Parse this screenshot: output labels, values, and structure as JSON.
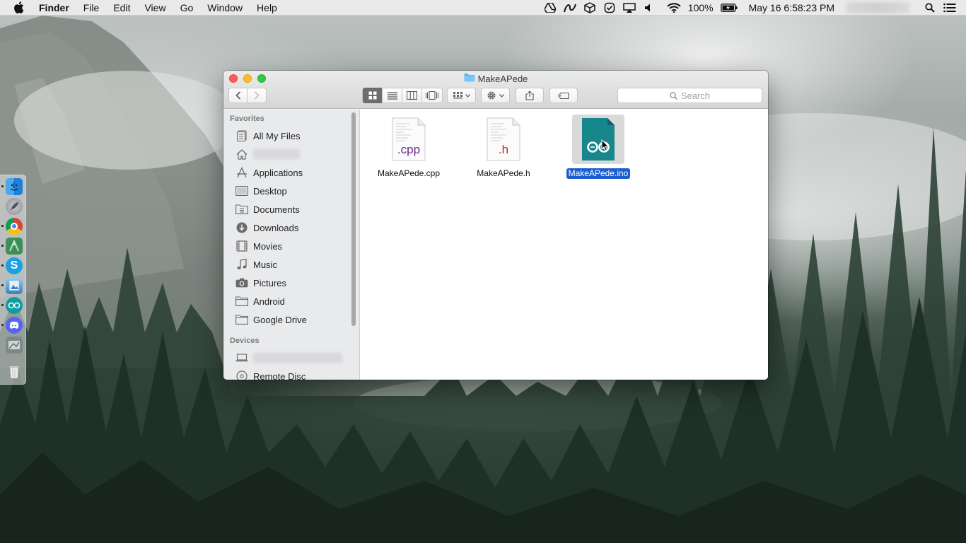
{
  "menubar": {
    "app_name": "Finder",
    "menus": [
      "File",
      "Edit",
      "View",
      "Go",
      "Window",
      "Help"
    ],
    "battery": "100%",
    "clock": "May 16  6:58:23 PM",
    "status_icons": [
      "google-drive-icon",
      "adobe-icon",
      "dropbox-icon",
      "checklist-icon",
      "airplay-icon",
      "volume-icon",
      "wifi-icon",
      "battery-icon",
      "spotlight-icon",
      "notification-center-icon"
    ]
  },
  "window": {
    "title": "MakeAPede",
    "search_placeholder": "Search"
  },
  "sidebar": {
    "favorites_header": "Favorites",
    "favorites": [
      {
        "label": "All My Files",
        "icon": "all-files-icon"
      },
      {
        "label": "",
        "icon": "home-icon"
      },
      {
        "label": "Applications",
        "icon": "applications-icon"
      },
      {
        "label": "Desktop",
        "icon": "desktop-icon"
      },
      {
        "label": "Documents",
        "icon": "documents-icon"
      },
      {
        "label": "Downloads",
        "icon": "downloads-icon"
      },
      {
        "label": "Movies",
        "icon": "movies-icon"
      },
      {
        "label": "Music",
        "icon": "music-icon"
      },
      {
        "label": "Pictures",
        "icon": "pictures-icon"
      },
      {
        "label": "Android",
        "icon": "folder-icon"
      },
      {
        "label": "Google Drive",
        "icon": "folder-icon"
      }
    ],
    "devices_header": "Devices",
    "devices": [
      {
        "label": "",
        "icon": "laptop-icon"
      },
      {
        "label": "Remote Disc",
        "icon": "remote-disc-icon"
      }
    ]
  },
  "files": [
    {
      "name": "MakeAPede.cpp",
      "badge": ".cpp",
      "badge_color": "#6a2a8a",
      "selected": false
    },
    {
      "name": "MakeAPede.h",
      "badge": ".h",
      "badge_color": "#b2322a",
      "selected": false
    },
    {
      "name": "MakeAPede.ino",
      "badge": "",
      "selected": true,
      "icon": "arduino-icon",
      "icon_color": "#1a8a8e"
    }
  ],
  "dock": [
    "finder-icon",
    "launchpad-icon",
    "chrome-icon",
    "android-studio-icon",
    "skype-icon",
    "preview-icon",
    "arduino-icon",
    "discord-icon",
    "photo-icon",
    "trash-icon"
  ]
}
